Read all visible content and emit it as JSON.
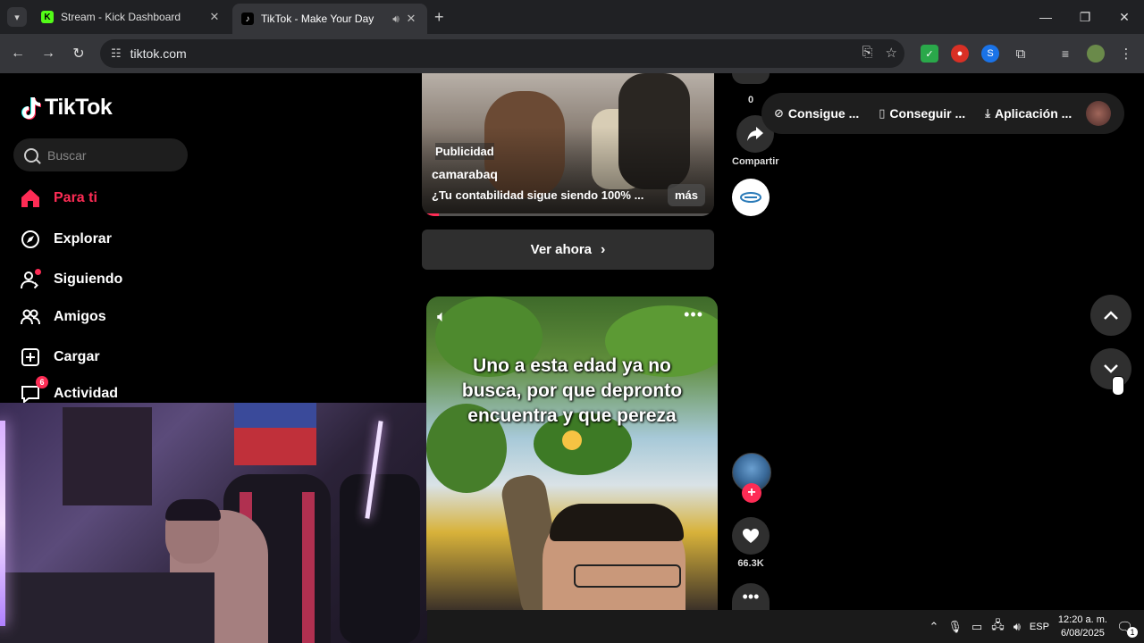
{
  "browser": {
    "tabs": [
      {
        "title": "Stream - Kick Dashboard",
        "favicon": "kick-icon",
        "active": false
      },
      {
        "title": "TikTok - Make Your Day",
        "favicon": "tiktok-icon",
        "active": true
      }
    ],
    "url": "tiktok.com"
  },
  "sidebar": {
    "logo": "TikTok",
    "search_placeholder": "Buscar",
    "items": [
      {
        "label": "Para ti",
        "icon": "home-icon",
        "active": true
      },
      {
        "label": "Explorar",
        "icon": "compass-icon"
      },
      {
        "label": "Siguiendo",
        "icon": "following-icon"
      },
      {
        "label": "Amigos",
        "icon": "friends-icon"
      },
      {
        "label": "Cargar",
        "icon": "upload-icon"
      },
      {
        "label": "Actividad",
        "icon": "activity-icon",
        "badge": "6"
      }
    ]
  },
  "ad": {
    "tag": "Publicidad",
    "account": "camarabaq",
    "description": "¿Tu contabilidad sigue siendo 100% ...",
    "more": "más",
    "cta": "Ver ahora",
    "progress": 0.04
  },
  "ad_actions": {
    "count": "0",
    "share_label": "Compartir"
  },
  "topbar": {
    "items": [
      {
        "label": "Consigue ...",
        "icon": "coin-icon"
      },
      {
        "label": "Conseguir ...",
        "icon": "phone-icon"
      },
      {
        "label": "Aplicación ...",
        "icon": "download-icon"
      }
    ]
  },
  "video": {
    "caption": "Uno a esta edad ya no busca, por que depronto encuentra y que pereza",
    "likes": "66.3K"
  },
  "taskbar": {
    "language": "ESP",
    "time": "12:20 a. m.",
    "date": "6/08/2025",
    "notifications": "1"
  },
  "colors": {
    "accent": "#fe2c55",
    "background": "#000000",
    "chrome": "#35363a"
  }
}
